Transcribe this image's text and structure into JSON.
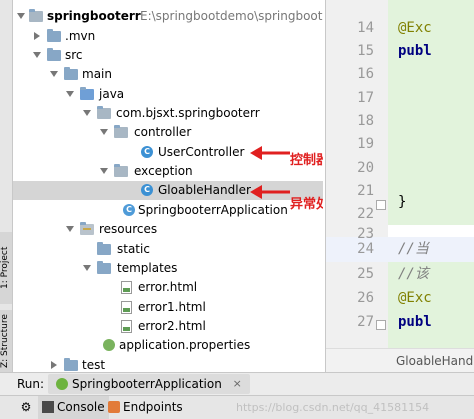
{
  "side_tabs": {
    "project": "1: Project",
    "structure": "Z: Structure"
  },
  "tree": {
    "root": {
      "name": "springbooterr",
      "path": "E:\\springbootdemo\\springbooterr"
    },
    "items": [
      {
        "label": ".mvn"
      },
      {
        "label": "src"
      },
      {
        "label": "main"
      },
      {
        "label": "java"
      },
      {
        "label": "com.bjsxt.springbooterr"
      },
      {
        "label": "controller"
      },
      {
        "label": "UserController"
      },
      {
        "label": "exception"
      },
      {
        "label": "GloableHandler"
      },
      {
        "label": "SpringbooterrApplication"
      },
      {
        "label": "resources"
      },
      {
        "label": "static"
      },
      {
        "label": "templates"
      },
      {
        "label": "error.html"
      },
      {
        "label": "error1.html"
      },
      {
        "label": "error2.html"
      },
      {
        "label": "application.properties"
      },
      {
        "label": "test"
      }
    ]
  },
  "annotations": {
    "controller_note": "控制器",
    "handler_note": "异常处理器",
    "color": "#e02020"
  },
  "editor": {
    "line_numbers": [
      "14",
      "15",
      "16",
      "17",
      "18",
      "19",
      "20",
      "21",
      "22",
      "23",
      "24",
      "25",
      "26",
      "27"
    ],
    "code": {
      "l14": "@Exc",
      "l15": "publ",
      "l22": "}",
      "l24": "//当",
      "l25": "//该",
      "l26": "@Exc",
      "l27": "publ"
    },
    "tab_label": "GloableHandle"
  },
  "run": {
    "label": "Run:",
    "tab": "SpringbooterrApplication",
    "close": "×"
  },
  "bottom": {
    "console": "Console",
    "endpoints": "Endpoints",
    "watermark": "https://blog.csdn.net/qq_41581154"
  }
}
